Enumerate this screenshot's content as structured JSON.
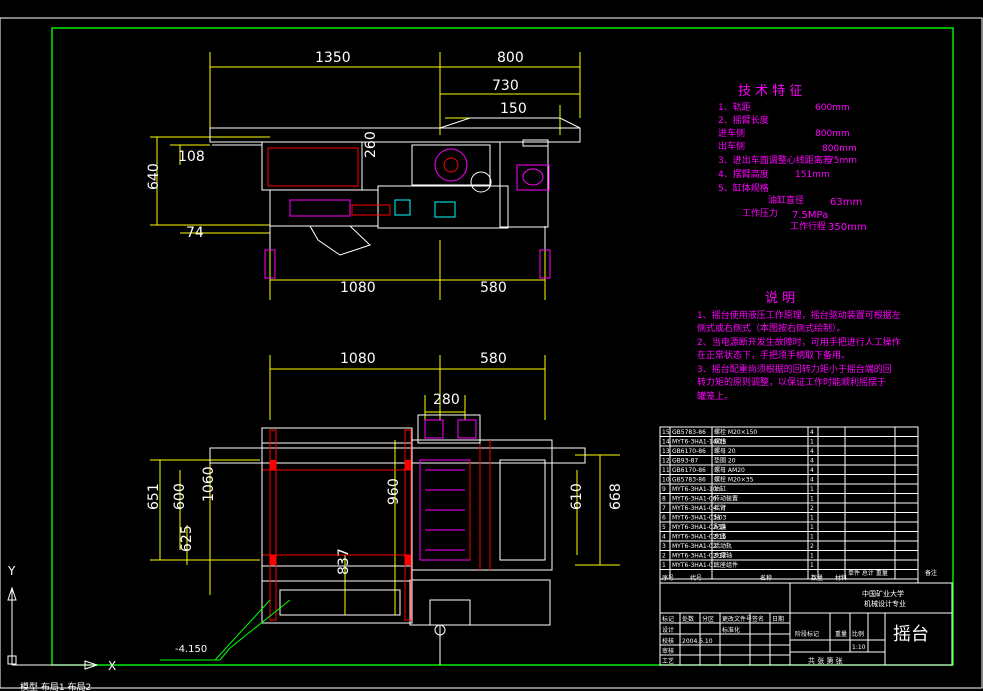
{
  "top_view": {
    "dims": {
      "d1350": "1350",
      "d800": "800",
      "d730": "730",
      "d150": "150",
      "d108": "108",
      "d260": "260",
      "d640": "640",
      "d74": "74",
      "d1080": "1080",
      "d580": "580"
    }
  },
  "bottom_view": {
    "dims": {
      "d1080": "1080",
      "d580": "580",
      "d280": "280",
      "d651": "651",
      "d600": "600",
      "d1060": "1060",
      "d625": "625",
      "d960": "960",
      "d837": "837",
      "d610": "610",
      "d668": "668"
    },
    "elevation": "-4.150"
  },
  "tech": {
    "title": "技 术 特 征",
    "items": [
      {
        "n": "1、轨距",
        "v": "600mm"
      },
      {
        "n": "2、摇臂长度",
        "v": ""
      },
      {
        "n": "   进车侧",
        "v": "800mm"
      },
      {
        "n": "   出车侧",
        "v": "800mm"
      },
      {
        "n": "3、进出车面调整心线距离差",
        "v": "75mm"
      },
      {
        "n": "4、摆臂高度",
        "v": "151mm"
      },
      {
        "n": "5、缸体规格",
        "v": ""
      }
    ],
    "cyl": {
      "l1": "油缸直径",
      "v1": "63mm",
      "l2": "工作压力",
      "v2": "7.5MPa",
      "l3": "工作行程",
      "v3": "350mm"
    }
  },
  "notes": {
    "title": "说    明",
    "lines": [
      "1、摇台使用液压工作原理，摇台驱动装置可根据左",
      "   侧式或右侧式（本图按右侧式绘制）。",
      "2、当电源断开发生故障时，可用手把进行人工操作",
      "   在正常状态下，手把须手柄取下备用。",
      "3、摇台配重尚须根据的回转力矩小于摇台端的回",
      "   转力矩的原则调整，以保证工作时能顺利摇摆于",
      "   罐笼上。"
    ]
  },
  "bom": {
    "rows": [
      {
        "no": "15",
        "code": "GB5783-86",
        "name": "螺栓 M20×150",
        "qty": "4"
      },
      {
        "no": "14",
        "code": "MYT6-3HA1-14-15",
        "name": "螺栓",
        "qty": "1"
      },
      {
        "no": "13",
        "code": "GB6170-86",
        "name": "螺母 20",
        "qty": "4"
      },
      {
        "no": "12",
        "code": "GB93-87",
        "name": "垫圈 20",
        "qty": "4"
      },
      {
        "no": "11",
        "code": "GB6170-86",
        "name": "螺母 AM20",
        "qty": "4"
      },
      {
        "no": "10",
        "code": "GB5783-86",
        "name": "螺栓 M20×35",
        "qty": "4"
      },
      {
        "no": "9",
        "code": "MYT6-3HA1-10",
        "name": "油缸",
        "qty": "1"
      },
      {
        "no": "8",
        "code": "MYT6-3HA1-06",
        "name": "传动装置",
        "qty": "1"
      },
      {
        "no": "7",
        "code": "MYT6-3HA1-04",
        "name": "摇臂",
        "qty": "2"
      },
      {
        "no": "6",
        "code": "MYT6-3HA1-03-03",
        "name": "轴",
        "qty": "1"
      },
      {
        "no": "5",
        "code": "MYT6-3HA1-02-14",
        "name": "配重",
        "qty": "1"
      },
      {
        "no": "4",
        "code": "MYT6-3HA1-02-15",
        "name": "支座",
        "qty": "1"
      },
      {
        "no": "3",
        "code": "MYT6-3HA1-02",
        "name": "活动轨",
        "qty": "2"
      },
      {
        "no": "2",
        "code": "MYT6-3HA1-02-12",
        "name": "支撑轴",
        "qty": "1"
      },
      {
        "no": "1",
        "code": "MYT6-3HA1-01",
        "name": "底座组件",
        "qty": "1"
      }
    ],
    "header": {
      "no": "序号",
      "code": "代号",
      "name": "名称",
      "qty": "数量",
      "mat": "材料",
      "wt": "单件 总计 重量",
      "rem": "备注"
    }
  },
  "titleblock": {
    "university": "中国矿业大学",
    "subtitle": "机械设计专业",
    "name": "摇台",
    "headers": [
      "标记",
      "处数",
      "分区",
      "更改文件号",
      "签名",
      "日期"
    ],
    "roles": [
      "设计",
      "校核",
      "审核",
      "工艺"
    ],
    "std_label": "标准化",
    "date": "2004.6.10",
    "stage": "阶段标记",
    "weight": "重量",
    "scale_label": "比例",
    "scale": "1:10",
    "sheets": "共 张  第 张"
  },
  "ucs": {
    "x": "X",
    "y": "Y"
  },
  "command": {
    "text": "模型  布局1  布局2"
  }
}
